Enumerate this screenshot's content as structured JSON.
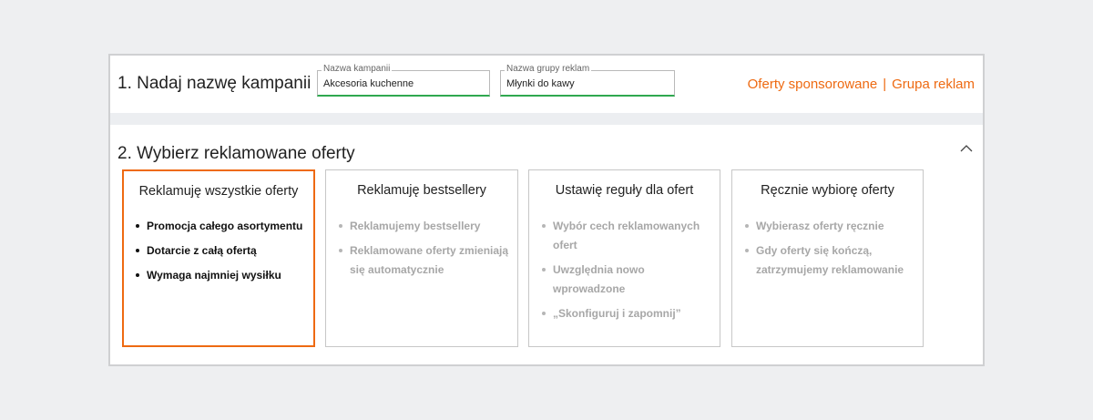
{
  "section1": {
    "title": "1. Nadaj nazwę kampanii",
    "campaign_name": {
      "legend": "Nazwa kampanii",
      "value": "Akcesoria kuchenne"
    },
    "ad_group_name": {
      "legend": "Nazwa grupy reklam",
      "value": "Młynki do kawy"
    },
    "context": {
      "part1": "Oferty sponsorowane",
      "separator": "|",
      "part2": "Grupa reklam"
    }
  },
  "section2": {
    "title": "2. Wybierz reklamowane oferty",
    "toggle_icon": "chevron-up-icon",
    "cards": [
      {
        "title": "Reklamuję wszystkie oferty",
        "selected": true,
        "items": [
          "Promocja całego asortymentu",
          "Dotarcie z całą ofertą",
          "Wymaga najmniej wysiłku"
        ]
      },
      {
        "title": "Reklamuję bestsellery",
        "selected": false,
        "items": [
          "Reklamujemy bestsellery",
          "Reklamowane oferty zmieniają się automatycznie"
        ]
      },
      {
        "title": "Ustawię reguły dla ofert",
        "selected": false,
        "items": [
          "Wybór cech reklamowanych ofert",
          "Uwzględnia nowo wprowadzone",
          "„Skonfiguruj i zapomnij”"
        ]
      },
      {
        "title": "Ręcznie wybiorę oferty",
        "selected": false,
        "items": [
          "Wybierasz oferty ręcznie",
          "Gdy oferty się kończą, zatrzymujemy reklamowanie"
        ]
      }
    ]
  },
  "colors": {
    "accent": "#ee6a12",
    "field_valid": "#2fa84f",
    "page_background": "#eeeff1",
    "muted_text": "#a7a7a7"
  }
}
